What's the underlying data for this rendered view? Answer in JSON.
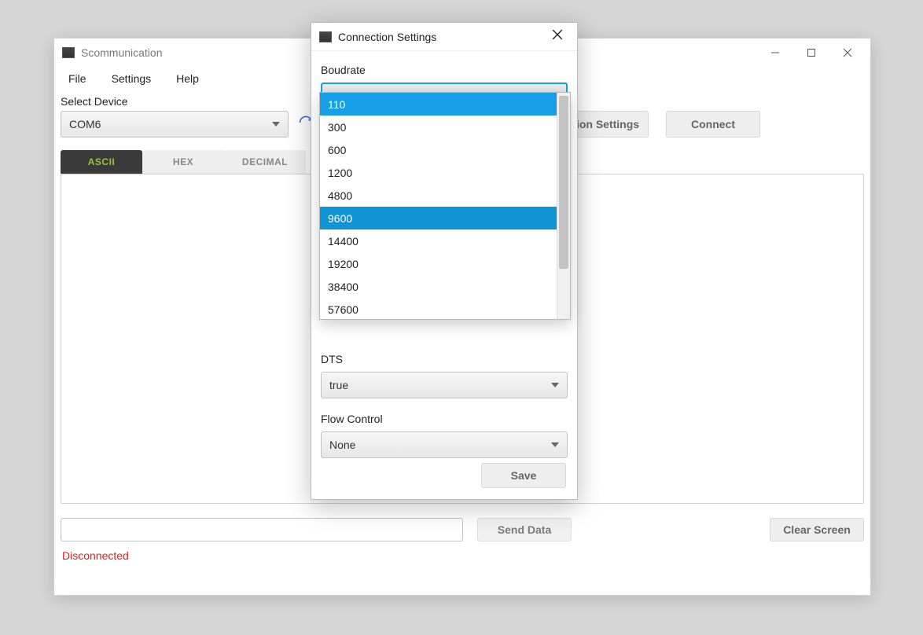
{
  "window": {
    "title": "Scommunication"
  },
  "menu": {
    "file": "File",
    "settings": "Settings",
    "help": "Help"
  },
  "device": {
    "label": "Select Device",
    "selected": "COM6"
  },
  "toolbar": {
    "connection_settings": "Connection Settings",
    "connect": "Connect"
  },
  "tabs": {
    "ascii": "ASCII",
    "hex": "HEX",
    "decimal": "DECIMAL"
  },
  "bottom": {
    "send": "Send Data",
    "clear": "Clear Screen"
  },
  "status": "Disconnected",
  "dialog": {
    "title": "Connection Settings",
    "baudrate_label": "Boudrate",
    "baudrate_value": "110",
    "baudrate_options": [
      "110",
      "300",
      "600",
      "1200",
      "4800",
      "9600",
      "14400",
      "19200",
      "38400",
      "57600"
    ],
    "dts_label": "DTS",
    "dts_value": "true",
    "flow_label": "Flow Control",
    "flow_value": "None",
    "save": "Save"
  }
}
